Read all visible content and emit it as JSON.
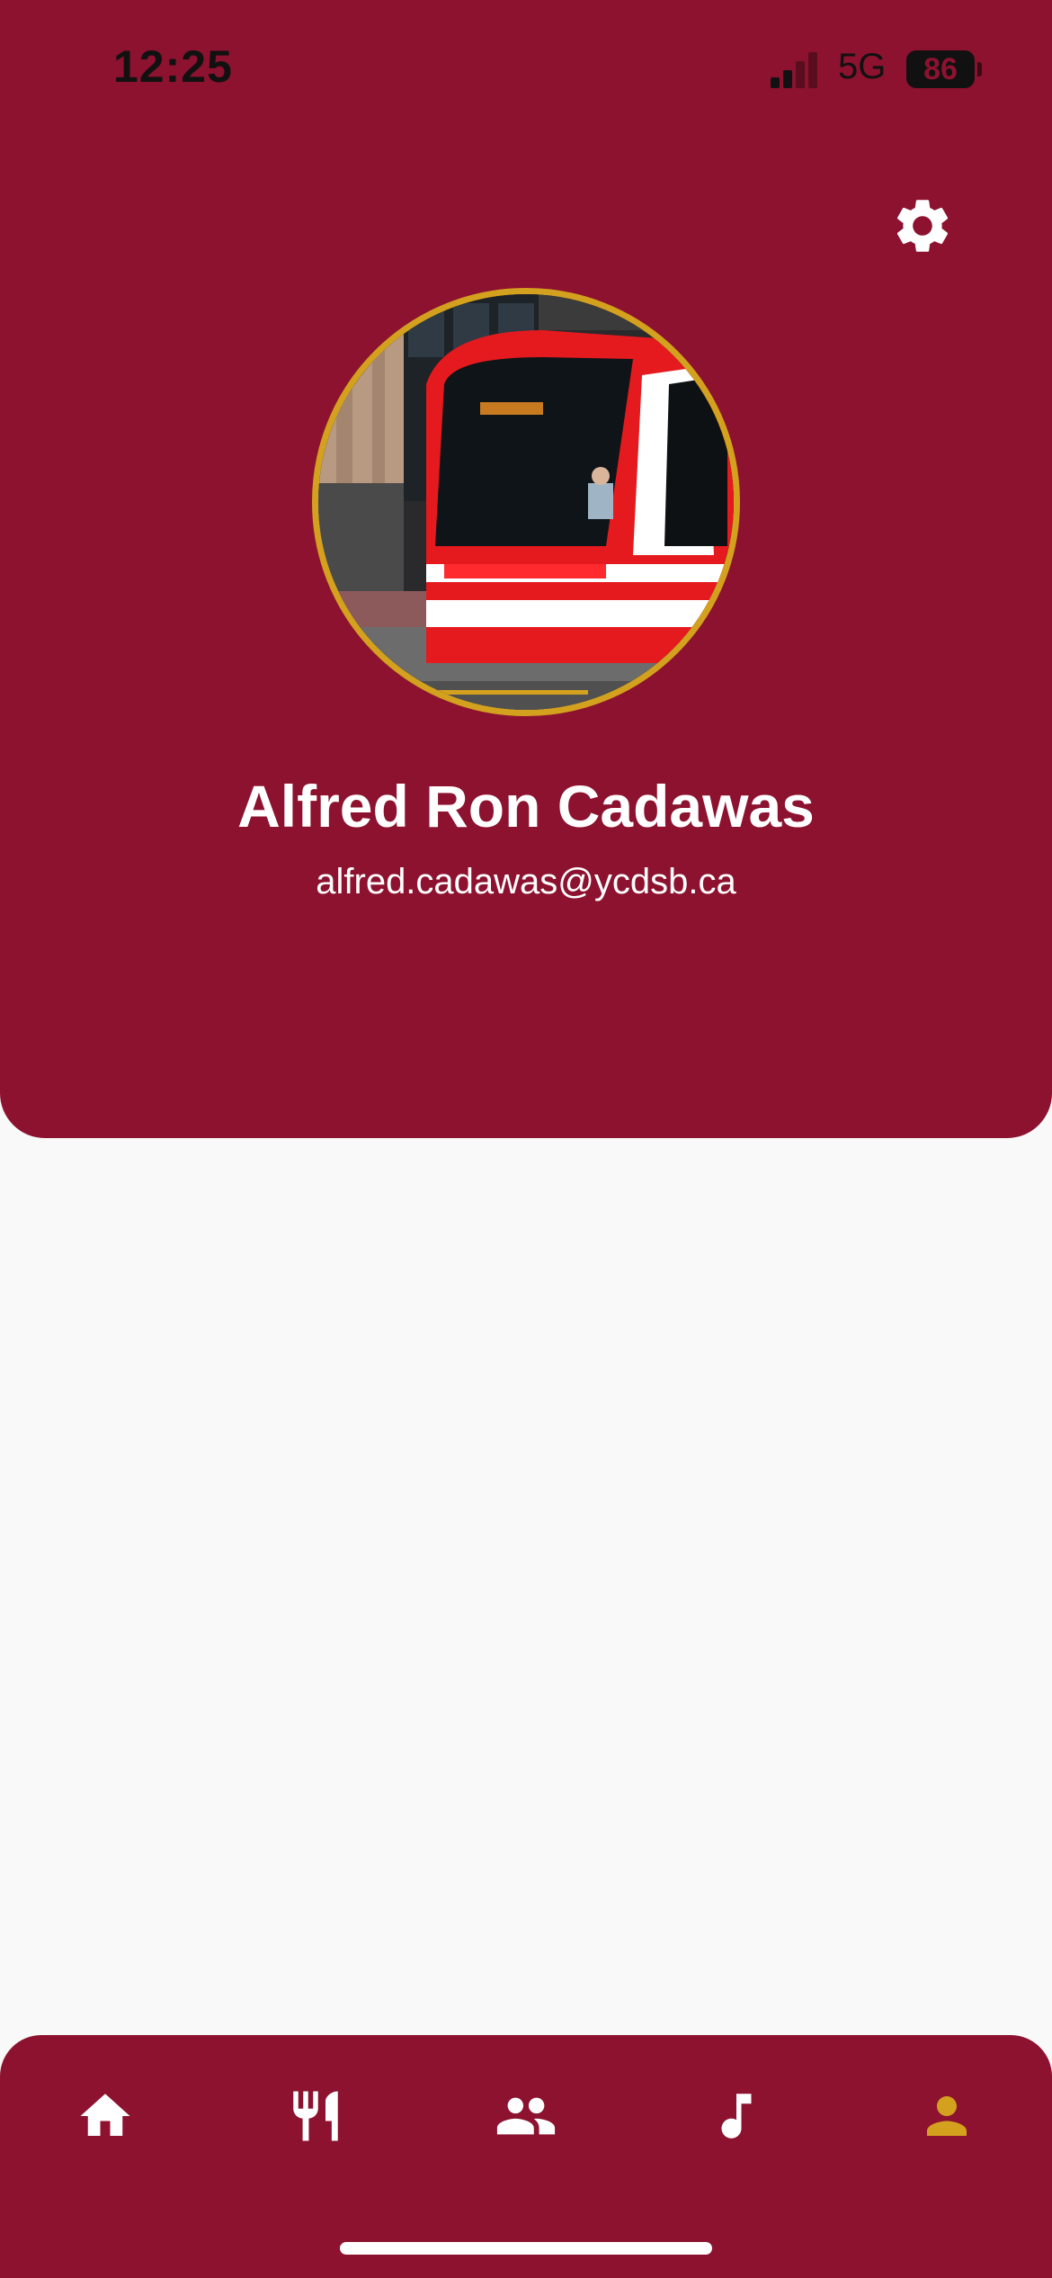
{
  "status_bar": {
    "time": "12:25",
    "network": "5G",
    "battery": "86"
  },
  "profile": {
    "name": "Alfred Ron Cadawas",
    "email": "alfred.cadawas@ycdsb.ca"
  },
  "icons": {
    "settings": "gear-icon",
    "home": "home-icon",
    "food": "fork-knife-icon",
    "people": "people-icon",
    "music": "music-note-icon",
    "profile": "person-icon"
  },
  "nav": {
    "active_tab": "profile"
  },
  "colors": {
    "primary": "#8c122f",
    "accent": "#d4a11e",
    "background": "#f9f9f9",
    "on_primary": "#ffffff"
  }
}
